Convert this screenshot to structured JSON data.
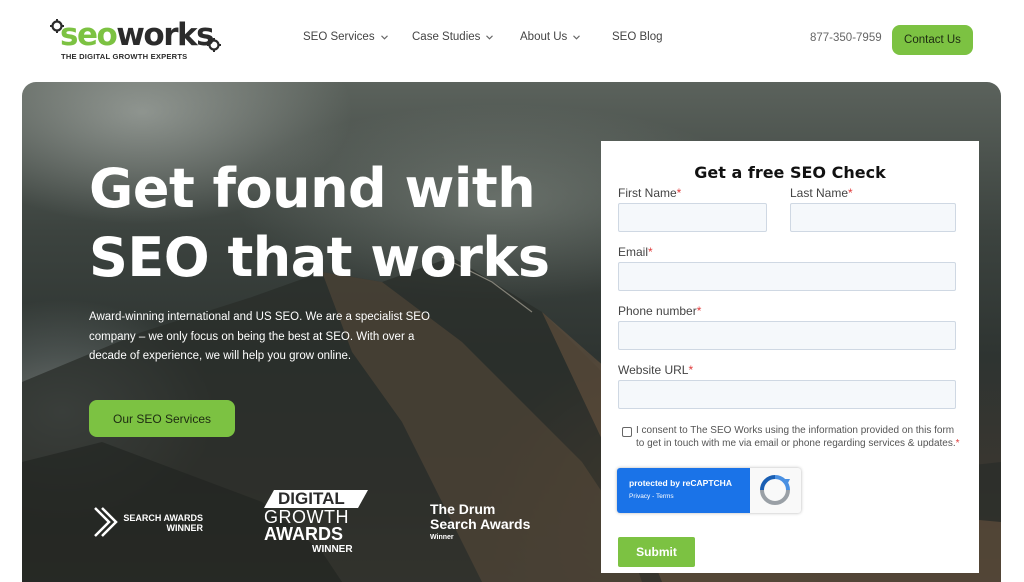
{
  "header": {
    "logo": {
      "word_seo": "seo",
      "word_works": "works",
      "tagline": "THE DIGITAL GROWTH EXPERTS"
    },
    "nav": [
      {
        "label": "SEO Services",
        "dropdown": true
      },
      {
        "label": "Case Studies",
        "dropdown": true
      },
      {
        "label": "About Us",
        "dropdown": true
      },
      {
        "label": "SEO Blog",
        "dropdown": false
      }
    ],
    "phone": "877-350-7959",
    "contact_label": "Contact Us"
  },
  "hero": {
    "headline_line1": "Get found with",
    "headline_line2": "SEO that works",
    "description": "Award-winning international and US SEO. We are a specialist SEO company – we only focus on being the best at SEO. With over a decade of experience, we will help you grow online.",
    "cta_label": "Our SEO Services",
    "awards": {
      "search_awards": {
        "line1": "SEARCH AWARDS",
        "line2": "WINNER"
      },
      "digital_growth": {
        "line1": "DIGITAL",
        "line2": "GROWTH",
        "line3": "AWARDS",
        "line4": "WINNER"
      },
      "drum": {
        "line1": "The Drum",
        "line2": "Search Awards",
        "line3": "Winner"
      }
    }
  },
  "form": {
    "title": "Get a free SEO Check",
    "required_mark": "*",
    "first_name_label": "First Name",
    "last_name_label": "Last Name",
    "email_label": "Email",
    "phone_label": "Phone number",
    "website_label": "Website URL",
    "consent_text": "I consent to The SEO Works using the information provided on this form to get in touch with me via email or phone regarding services & updates.",
    "recaptcha_line1": "protected by reCAPTCHA",
    "recaptcha_line2": "Privacy - Terms",
    "submit_label": "Submit"
  },
  "colors": {
    "accent": "#7cc242",
    "dark_text": "#2b2b2b",
    "required": "#e03b3b",
    "recaptcha_blue": "#1a73e8"
  },
  "icons": [
    "gear-icon",
    "chevron-down-icon",
    "recaptcha-icon",
    "award-arrow-icon"
  ]
}
